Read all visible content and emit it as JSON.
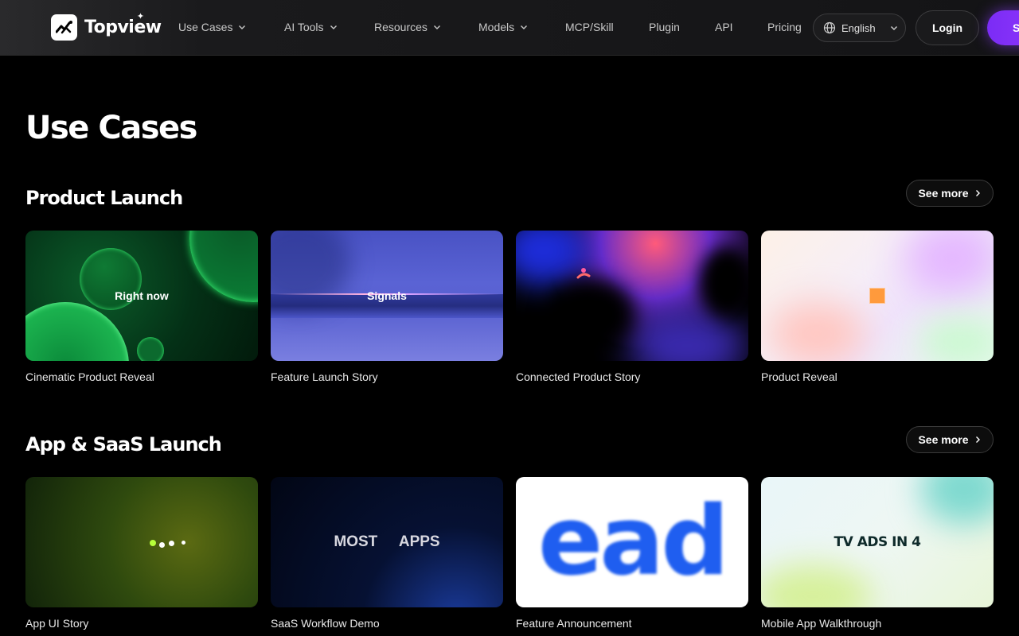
{
  "brand": {
    "name": "Topview"
  },
  "nav": {
    "items": [
      {
        "label": "Use Cases",
        "dropdown": true
      },
      {
        "label": "AI Tools",
        "dropdown": true
      },
      {
        "label": "Resources",
        "dropdown": true
      },
      {
        "label": "Models",
        "dropdown": true
      },
      {
        "label": "MCP/Skill",
        "dropdown": false
      },
      {
        "label": "Plugin",
        "dropdown": false
      },
      {
        "label": "API",
        "dropdown": false
      },
      {
        "label": "Pricing",
        "dropdown": false
      }
    ],
    "language": "English",
    "login_label": "Login",
    "signup_label": "Sign up"
  },
  "page": {
    "title": "Use Cases"
  },
  "sections": [
    {
      "title": "Product Launch",
      "see_more": "See more",
      "cards": [
        {
          "label": "Cinematic Product Reveal",
          "overlay": "Right now"
        },
        {
          "label": "Feature Launch Story",
          "overlay": "Signals"
        },
        {
          "label": "Connected Product Story",
          "overlay": ""
        },
        {
          "label": "Product Reveal",
          "overlay": ""
        }
      ]
    },
    {
      "title": "App & SaaS Launch",
      "see_more": "See more",
      "cards": [
        {
          "label": "App UI Story",
          "overlay": ""
        },
        {
          "label": "SaaS Workflow Demo",
          "overlay": "MOST APPS"
        },
        {
          "label": "Feature Announcement",
          "overlay": "ead"
        },
        {
          "label": "Mobile App Walkthrough",
          "overlay": "TV ADS IN 4"
        }
      ]
    }
  ],
  "colors": {
    "accent": "#8a34f8",
    "background": "#000000"
  }
}
